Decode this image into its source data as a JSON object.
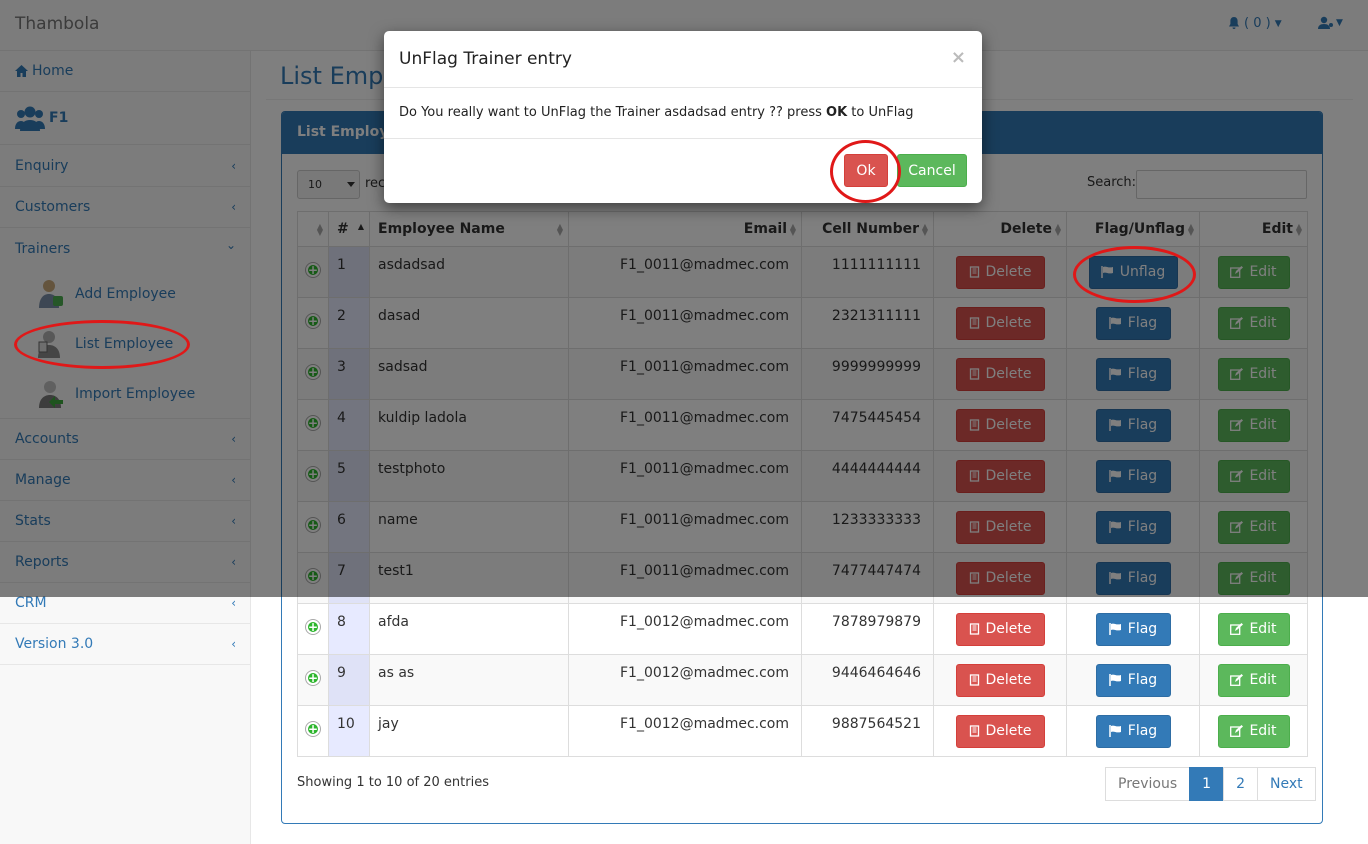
{
  "topbar": {
    "brand": "Thambola",
    "notif_count": "( 0 )"
  },
  "sidebar": {
    "home": "Home",
    "org": "F1",
    "items": [
      {
        "label": "Enquiry"
      },
      {
        "label": "Customers"
      },
      {
        "label": "Trainers"
      },
      {
        "label": "Accounts"
      },
      {
        "label": "Manage"
      },
      {
        "label": "Stats"
      },
      {
        "label": "Reports"
      },
      {
        "label": "CRM"
      },
      {
        "label": "Version 3.0"
      }
    ],
    "sub_items": [
      {
        "label": "Add Employee"
      },
      {
        "label": "List Employee"
      },
      {
        "label": "Import Employee"
      }
    ]
  },
  "main": {
    "page_title": "List Employee",
    "panel_title": "List Employee",
    "length_value": "10",
    "length_text": "records per page",
    "search_label": "Search:",
    "columns": [
      "",
      "#",
      "Employee Name",
      "Email",
      "Cell Number",
      "Delete",
      "Flag/Unflag",
      "Edit"
    ],
    "rows": [
      {
        "num": "1",
        "name": "asdadsad",
        "email": "F1_0011@madmec.com",
        "cell": "1111111111",
        "flag": "Unflag"
      },
      {
        "num": "2",
        "name": "dasad",
        "email": "F1_0011@madmec.com",
        "cell": "2321311111",
        "flag": "Flag"
      },
      {
        "num": "3",
        "name": "sadsad",
        "email": "F1_0011@madmec.com",
        "cell": "9999999999",
        "flag": "Flag"
      },
      {
        "num": "4",
        "name": "kuldip ladola",
        "email": "F1_0011@madmec.com",
        "cell": "7475445454",
        "flag": "Flag"
      },
      {
        "num": "5",
        "name": "testphoto",
        "email": "F1_0011@madmec.com",
        "cell": "4444444444",
        "flag": "Flag"
      },
      {
        "num": "6",
        "name": "name",
        "email": "F1_0011@madmec.com",
        "cell": "1233333333",
        "flag": "Flag"
      },
      {
        "num": "7",
        "name": "test1",
        "email": "F1_0011@madmec.com",
        "cell": "7477447474",
        "flag": "Flag"
      },
      {
        "num": "8",
        "name": "afda",
        "email": "F1_0012@madmec.com",
        "cell": "7878979879",
        "flag": "Flag"
      },
      {
        "num": "9",
        "name": "as as",
        "email": "F1_0012@madmec.com",
        "cell": "9446464646",
        "flag": "Flag"
      },
      {
        "num": "10",
        "name": "jay",
        "email": "F1_0012@madmec.com",
        "cell": "9887564521",
        "flag": "Flag"
      }
    ],
    "delete_label": "Delete",
    "edit_label": "Edit",
    "info": "Showing 1 to 10 of 20 entries",
    "pager": {
      "prev": "Previous",
      "pages": [
        "1",
        "2"
      ],
      "next": "Next"
    }
  },
  "modal": {
    "title": "UnFlag Trainer entry",
    "close": "×",
    "body_pre": "Do You really want to UnFlag the Trainer asdadsad entry ?? press ",
    "body_bold": "OK",
    "body_post": " to UnFlag",
    "ok_label": "Ok",
    "cancel_label": "Cancel"
  },
  "colors": {
    "primary": "#337ab7",
    "danger": "#d9534f",
    "success": "#5cb85c",
    "highlight_ring": "#e01818"
  }
}
